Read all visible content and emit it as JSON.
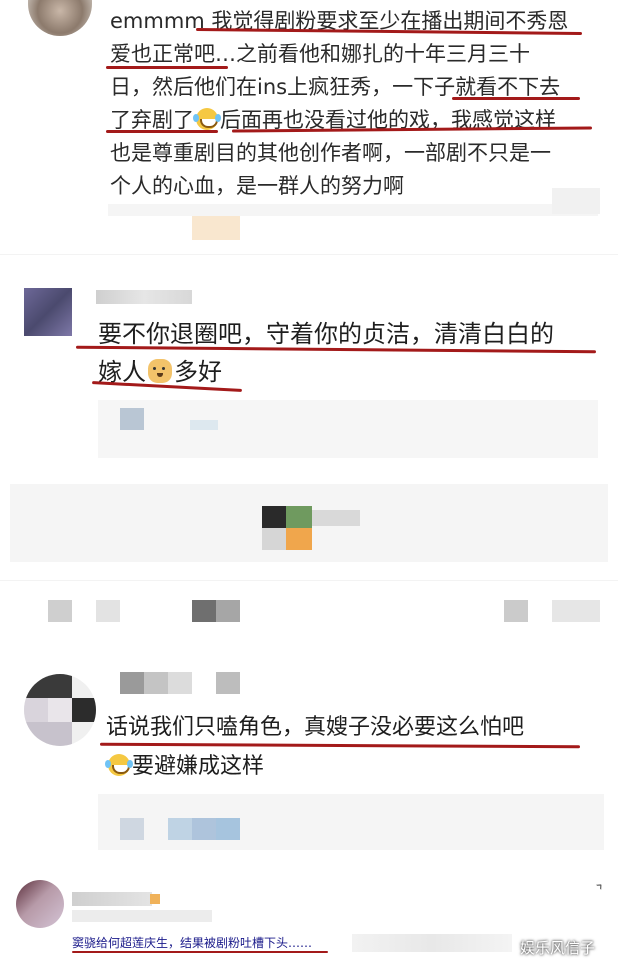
{
  "comments": [
    {
      "lines": [
        "emmmm 我觉得剧粉要求至少在播出期间不秀恩",
        "爱也正常吧…之前看他和娜扎的十年三月三十",
        "日，然后他们在ins上疯狂秀，一下子就看不下去",
        "了弃剧了",
        "后面再也没看过他的戏，我感觉这样",
        "也是尊重剧目的其他创作者啊，一部剧不只是一",
        "个人的心血，是一群人的努力啊"
      ],
      "emoji": "laughing-crying-emoji"
    },
    {
      "lines": [
        "要不你退圈吧，守着你的贞洁，清清白白的",
        "嫁人",
        "多好"
      ],
      "emoji": "doge-emoji"
    },
    {
      "lines": [
        "话说我们只嗑角色，真嫂子没必要这么怕吧",
        "要避嫌成这样"
      ],
      "emoji": "laughing-crying-emoji"
    }
  ],
  "footer": {
    "headline": "窦骁给何超莲庆生，结果被剧粉吐槽下头……"
  },
  "watermark": "娱乐风信子",
  "colors": {
    "underline": "#a31a1a",
    "text": "#2a2a2a",
    "headline": "#1a1a8a"
  }
}
